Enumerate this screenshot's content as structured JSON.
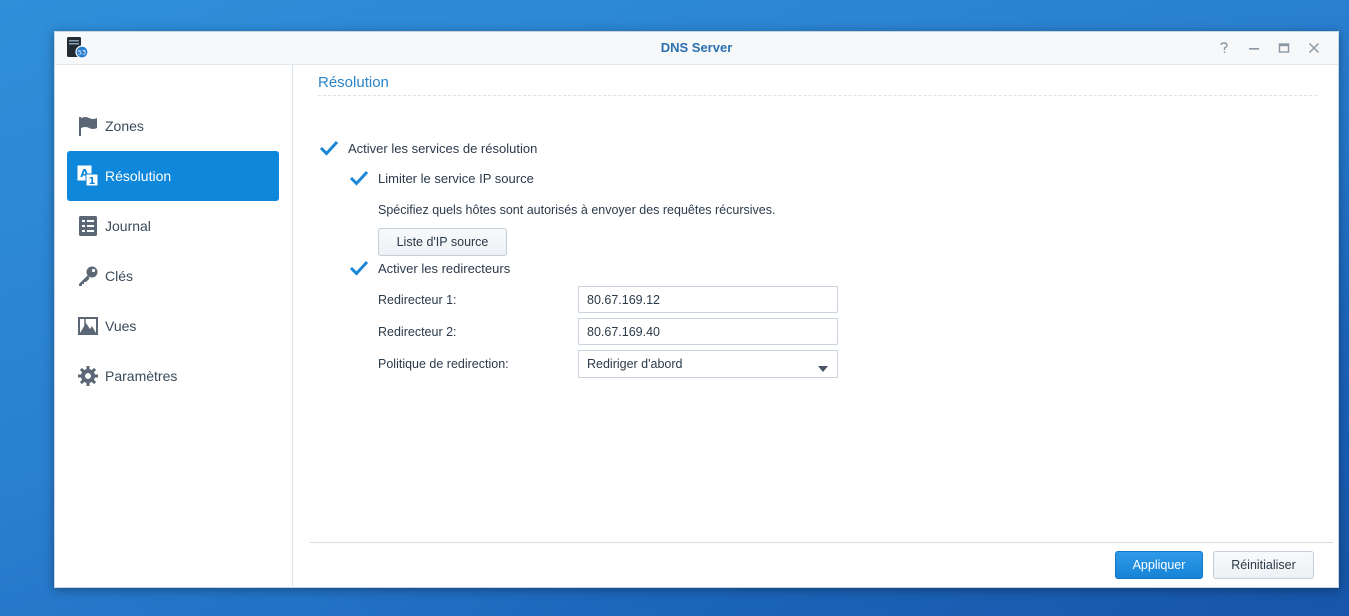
{
  "window": {
    "title": "DNS Server",
    "controls": [
      {
        "name": "help-icon"
      },
      {
        "name": "minimize-icon"
      },
      {
        "name": "maximize-icon"
      },
      {
        "name": "close-icon"
      }
    ]
  },
  "sidebar": {
    "items": [
      {
        "label": "Zones",
        "icon": "flag-icon",
        "active": false
      },
      {
        "label": "Résolution",
        "icon": "resolution-icon",
        "active": true
      },
      {
        "label": "Journal",
        "icon": "log-list-icon",
        "active": false
      },
      {
        "label": "Clés",
        "icon": "key-icon",
        "active": false
      },
      {
        "label": "Vues",
        "icon": "map-view-icon",
        "active": false
      },
      {
        "label": "Paramètres",
        "icon": "gear-icon",
        "active": false
      }
    ]
  },
  "main": {
    "section_title": "Résolution",
    "enable_resolution": {
      "label": "Activer les services de résolution",
      "checked": true
    },
    "limit_source_ip": {
      "label": "Limiter le service IP source",
      "checked": true
    },
    "limit_description": "Spécifiez quels hôtes sont autorisés à envoyer des requêtes récursives.",
    "source_ip_list_button": "Liste d'IP source",
    "enable_forwarders": {
      "label": "Activer les redirecteurs",
      "checked": true
    },
    "forwarder1": {
      "label": "Redirecteur 1:",
      "value": "80.67.169.12"
    },
    "forwarder2": {
      "label": "Redirecteur 2:",
      "value": "80.67.169.40"
    },
    "policy": {
      "label": "Politique de redirection:",
      "value": "Rediriger d'abord"
    }
  },
  "footer": {
    "apply_label": "Appliquer",
    "reset_label": "Réinitialiser"
  },
  "colors": {
    "accent": "#0f87db",
    "title_blue": "#2a70b0",
    "checkmark": "#1a86d6"
  }
}
